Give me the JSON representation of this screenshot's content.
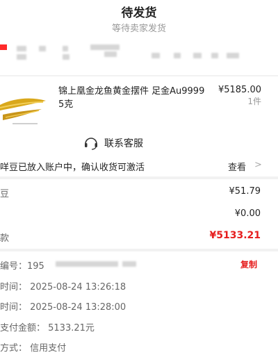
{
  "header": {
    "title": "待发货",
    "subtitle": "等待卖家发货"
  },
  "product": {
    "title": "锦上凰金龙鱼黄金摆件 足金Au9999 5克",
    "price": "¥5185.00",
    "qty": "1件",
    "service_label": "联系客服"
  },
  "notice": {
    "text": "咩豆已放入账户中，确认收货可激活",
    "link_label": "查看",
    "chevron": ">"
  },
  "amounts": [
    {
      "label": "豆",
      "value": "¥51.79"
    },
    {
      "label": "",
      "value": "¥0.00"
    },
    {
      "label": "款",
      "value": "¥5133.21"
    }
  ],
  "details": {
    "order_no_label": "编号：",
    "order_no_visible": "195",
    "copy_label": "复制",
    "time1": "时间：  2025-08-24 13:26:18",
    "time2": "时间：  2025-08-24 13:28:00",
    "paid": "支付金额：  5133.21元",
    "method": "方式：  信用支付"
  },
  "colors": {
    "accent_red": "#e61e1e",
    "gold": "#d9a81c"
  }
}
